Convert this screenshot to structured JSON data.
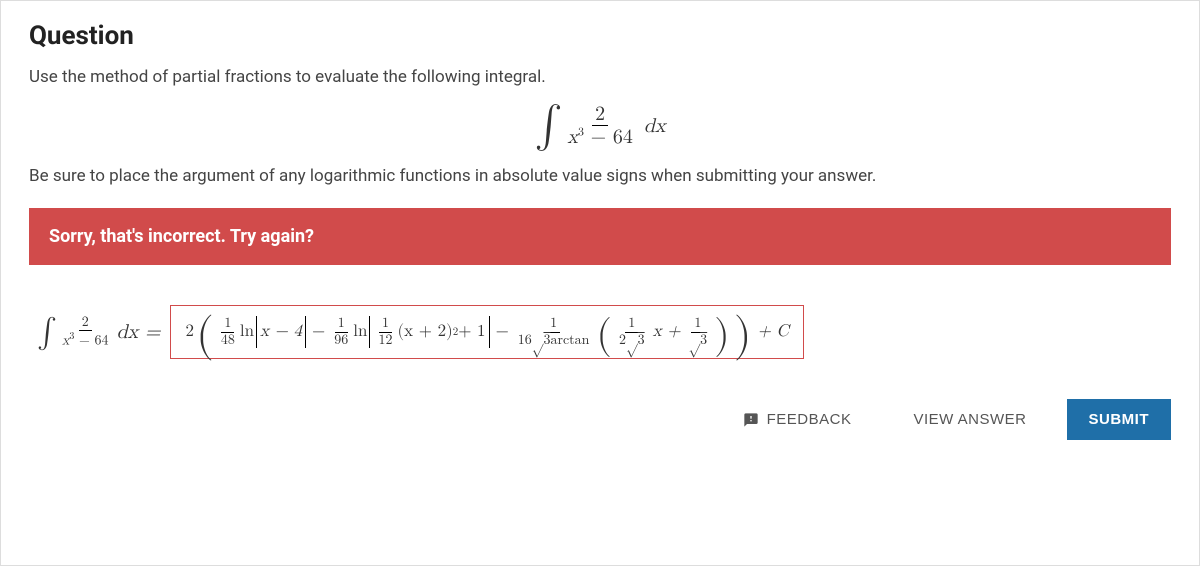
{
  "title": "Question",
  "prompt": "Use the method of partial fractions to evaluate the following integral.",
  "integral": {
    "numerator": "2",
    "denominator_left": "x",
    "denominator_exp": "3",
    "denominator_right": " − 64",
    "dx": "dx"
  },
  "hint": "Be sure to place the argument of any logarithmic functions in absolute value signs when submitting your answer.",
  "error": "Sorry, that's incorrect. Try again?",
  "lhs": {
    "int_num": "2",
    "int_den_a": "x",
    "int_den_exp": "3",
    "int_den_b": " − 64",
    "dx_eq": "dx ="
  },
  "answer": {
    "leading2": "2",
    "f1_num": "1",
    "f1_den": "48",
    "ln1": "ln",
    "abs1_a": "x − 4",
    "minus1": "−",
    "f2_num": "1",
    "f2_den": "96",
    "ln2": "ln",
    "f3_num": "1",
    "f3_den": "12",
    "poly": "(x + 2)",
    "poly_exp": "2",
    "poly_tail": " + 1",
    "minus2": "−",
    "g1_num": "1",
    "g1_den_a": "16",
    "g1_den_sqrt": "3",
    "arctan": "arctan",
    "h1_num": "1",
    "h1_den_a": "2",
    "h1_den_sqrt": "3",
    "x_plus": "x +",
    "h2_num": "1",
    "h2_den_sqrt": "3",
    "plusC": "+ C"
  },
  "buttons": {
    "feedback": "FEEDBACK",
    "view_answer": "VIEW ANSWER",
    "submit": "SUBMIT"
  }
}
